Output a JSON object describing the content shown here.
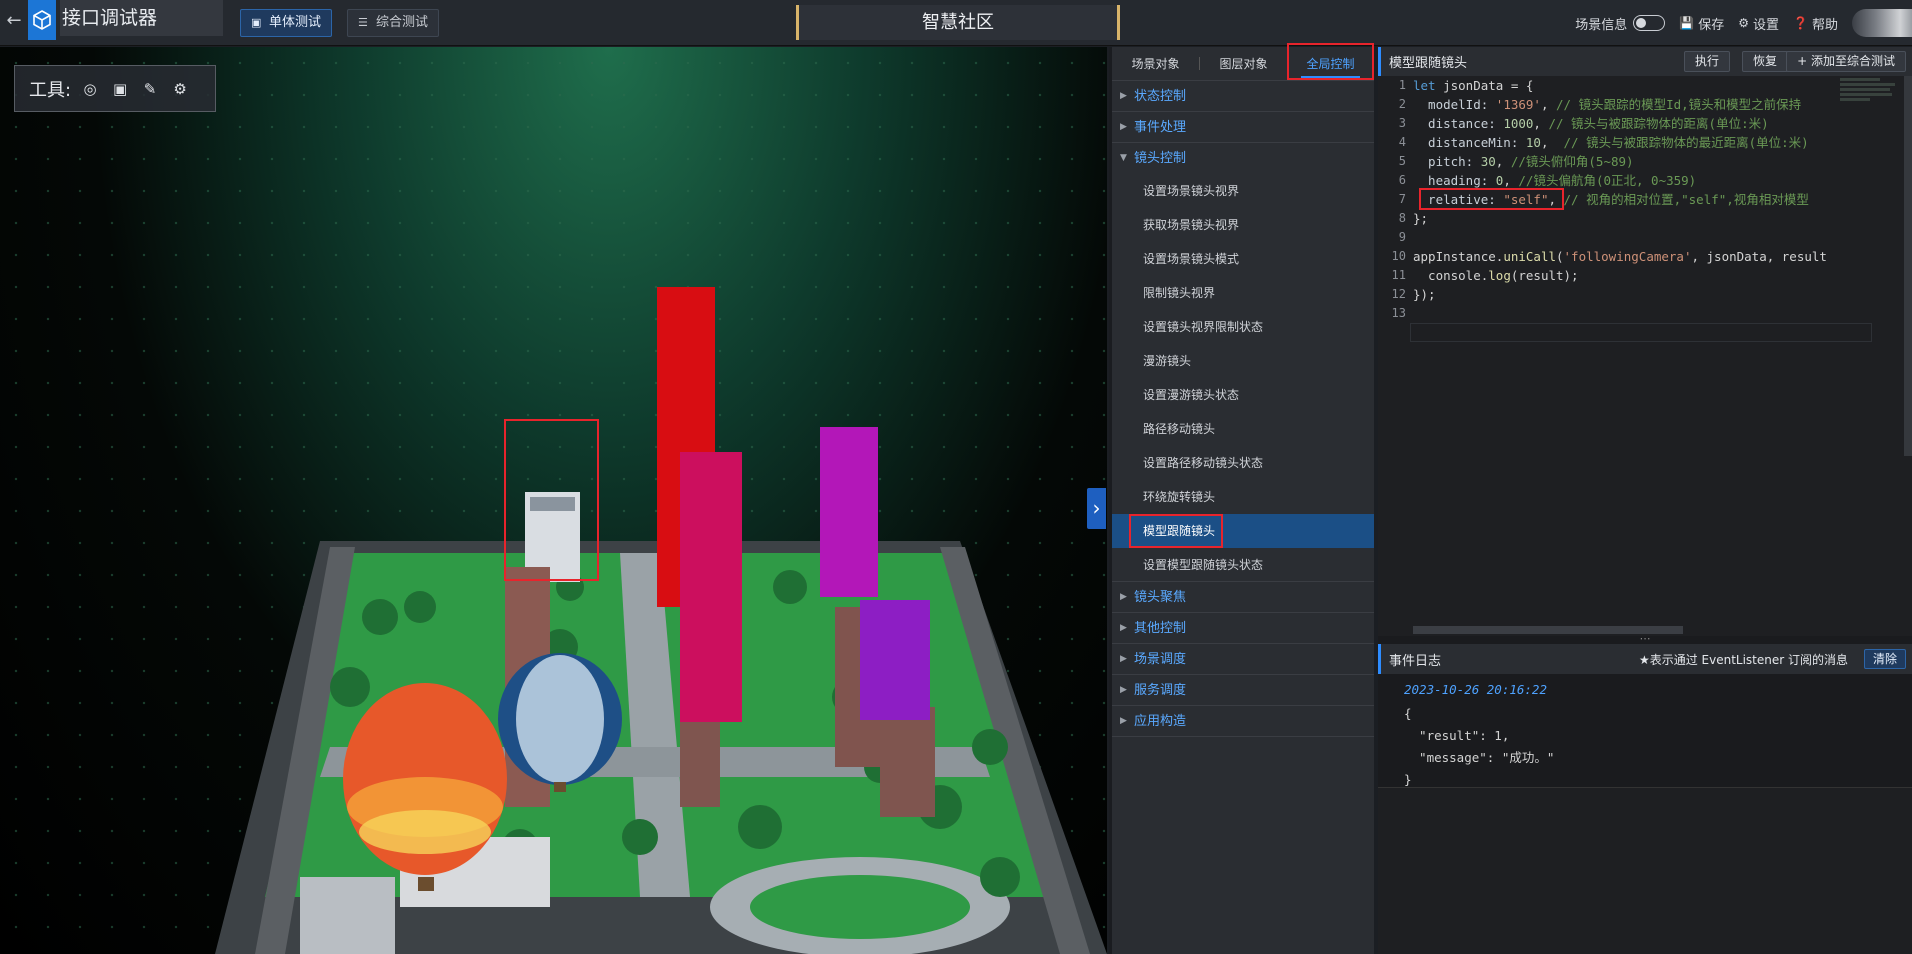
{
  "app": {
    "title": "接口调试器",
    "back_icon": "arrow-left-icon",
    "logo_icon": "cube-logo-icon"
  },
  "modes": [
    {
      "label": "单体测试",
      "icon": "cube-icon",
      "active": true
    },
    {
      "label": "综合测试",
      "icon": "layers-icon",
      "active": false
    }
  ],
  "scene_title": "智慧社区",
  "top_right": {
    "scene_info_label": "场景信息",
    "scene_info_on": false,
    "save_label": "保存",
    "settings_label": "设置",
    "help_label": "帮助"
  },
  "tools": {
    "label": "工具:",
    "icons": [
      "location-pin-icon",
      "focus-frame-icon",
      "pen-icon",
      "gears-icon"
    ]
  },
  "left_panel": {
    "tabs": [
      {
        "label": "场景对象",
        "active": false
      },
      {
        "label": "图层对象",
        "active": false
      },
      {
        "label": "全局控制",
        "active": true
      }
    ],
    "groups_before": [
      {
        "label": "状态控制",
        "expanded": false
      },
      {
        "label": "事件处理",
        "expanded": false
      }
    ],
    "open_group": {
      "label": "镜头控制",
      "expanded": true
    },
    "items": [
      "设置场景镜头视界",
      "获取场景镜头视界",
      "设置场景镜头模式",
      "限制镜头视界",
      "设置镜头视界限制状态",
      "漫游镜头",
      "设置漫游镜头状态",
      "路径移动镜头",
      "设置路径移动镜头状态",
      "环绕旋转镜头",
      "模型跟随镜头",
      "设置模型跟随镜头状态"
    ],
    "selected_item": "模型跟随镜头",
    "groups_after": [
      {
        "label": "镜头聚焦",
        "expanded": false
      },
      {
        "label": "其他控制",
        "expanded": false
      },
      {
        "label": "场景调度",
        "expanded": false
      },
      {
        "label": "服务调度",
        "expanded": false
      },
      {
        "label": "应用构造",
        "expanded": false
      }
    ]
  },
  "editor": {
    "title": "模型跟随镜头",
    "run_label": "执行",
    "restore_label": "恢复",
    "add_label": "添加至综合测试",
    "line_numbers": [
      "1",
      "2",
      "3",
      "4",
      "5",
      "6",
      "7",
      "8",
      "9",
      "10",
      "11",
      "12",
      "13"
    ],
    "code": {
      "l1_kw": "let",
      "l1_rest": " jsonData = {",
      "l2_key": "  modelId: ",
      "l2_val": "'1369'",
      "l2_sep": ", ",
      "l2_cm": "// 镜头跟踪的模型Id,镜头和模型之前保持",
      "l3_key": "  distance: ",
      "l3_val": "1000",
      "l3_sep": ", ",
      "l3_cm": "// 镜头与被跟踪物体的距离(单位:米)",
      "l4_key": "  distanceMin: ",
      "l4_val": "10",
      "l4_sep": ",  ",
      "l4_cm": "// 镜头与被跟踪物体的最近距离(单位:米)",
      "l5_key": "  pitch: ",
      "l5_val": "30",
      "l5_sep": ", ",
      "l5_cm": "//镜头俯仰角(5~89)",
      "l6_key": "  heading: ",
      "l6_val": "0",
      "l6_sep": ", ",
      "l6_cm": "//镜头偏航角(0正北, 0~359)",
      "l7_key": "  relative: ",
      "l7_val": "\"self\"",
      "l7_sep": ", ",
      "l7_cm": "// 视角的相对位置,\"self\",视角相对模型",
      "l8": "};",
      "l9": "",
      "l10_obj": "appInstance.",
      "l10_fn": "uniCall",
      "l10_open": "(",
      "l10_str": "'followingCamera'",
      "l10_rest": ", jsonData, result",
      "l11_obj": "  console.",
      "l11_fn": "log",
      "l11_rest": "(result);",
      "l12": "});",
      "l13": ""
    }
  },
  "event_log": {
    "title": "事件日志",
    "note": "★表示通过 EventListener 订阅的消息",
    "clear_label": "清除",
    "timestamp": "2023-10-26 20:16:22",
    "lines": [
      "{",
      "  \"result\": 1,",
      "  \"message\": \"成功。\"",
      "}"
    ]
  },
  "colors": {
    "accent": "#2d8cff",
    "highlight": "#e8242c",
    "selected_bg": "#1b4f86"
  }
}
